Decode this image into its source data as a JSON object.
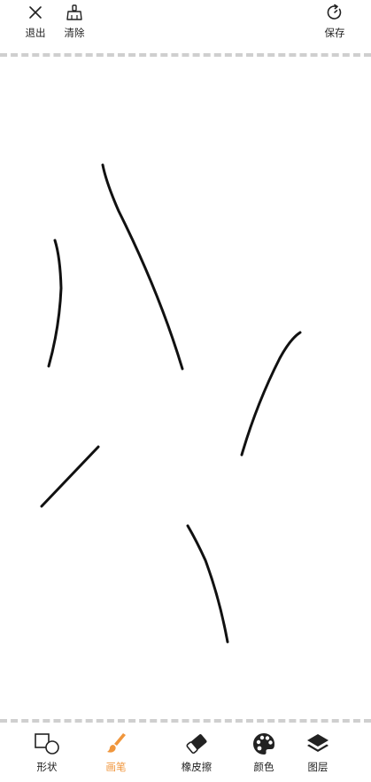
{
  "header": {
    "exit_label": "退出",
    "clear_label": "清除",
    "save_label": "保存"
  },
  "toolbar": {
    "active_tool": "brush",
    "accent_color": "#f0963c",
    "tools": [
      {
        "id": "shape",
        "label": "形状",
        "icon": "shapes-icon"
      },
      {
        "id": "brush",
        "label": "画笔",
        "icon": "brush-icon"
      },
      {
        "id": "eraser",
        "label": "橡皮擦",
        "icon": "eraser-icon"
      },
      {
        "id": "color",
        "label": "颜色",
        "icon": "palette-icon"
      },
      {
        "id": "layer",
        "label": "图层",
        "icon": "layers-icon"
      }
    ]
  },
  "canvas": {
    "background": "#ffffff",
    "stroke_color": "#111111"
  }
}
